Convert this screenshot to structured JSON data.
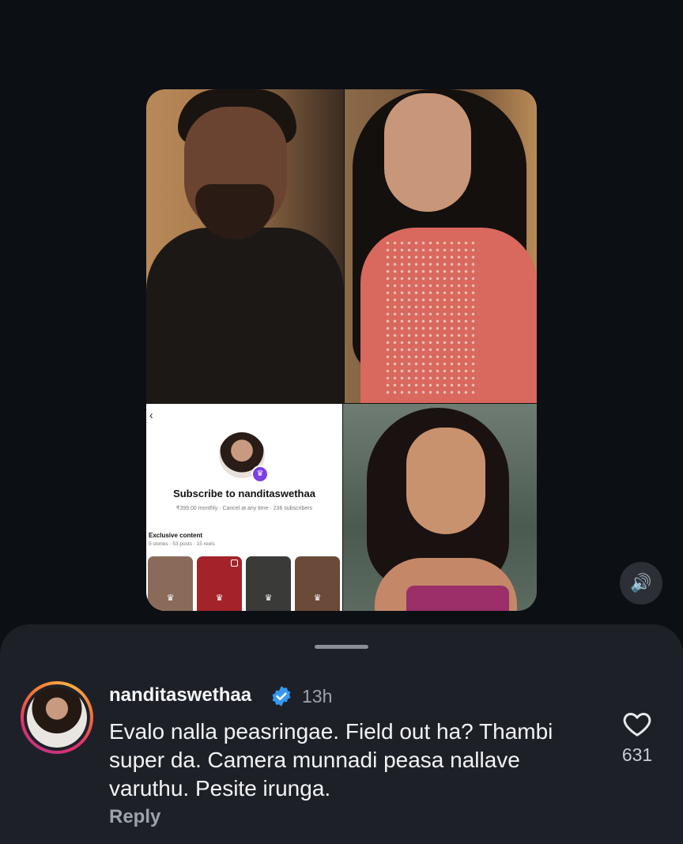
{
  "post": {
    "subscribe_panel": {
      "back_icon": "chevron-left-icon",
      "title": "Subscribe to nanditaswethaa",
      "meta": "₹399.00 monthly · Cancel at any time · 236 subscribers",
      "exclusive_heading": "Exclusive content",
      "exclusive_counts": "5 stories · 53 posts · 15 reels",
      "thumbs": [
        {
          "color": "#8a6b5a",
          "icon": "crown-icon"
        },
        {
          "color": "#a4232a",
          "icon": "crown-icon"
        },
        {
          "color": "#3a3a38",
          "icon": "crown-icon"
        },
        {
          "color": "#6b4a3a",
          "icon": "crown-icon"
        }
      ],
      "accent": "#7b3fe4"
    },
    "sound_icon": "speaker-icon"
  },
  "comment_sheet": {
    "username": "nanditaswethaa",
    "verified_color": "#3897f0",
    "timestamp": "13h",
    "text": "Evalo nalla peasringae. Field out ha? Thambi super da. Camera munnadi peasa nallave varuthu. Pesite irunga.",
    "reply_label": "Reply",
    "like_count": "631"
  }
}
